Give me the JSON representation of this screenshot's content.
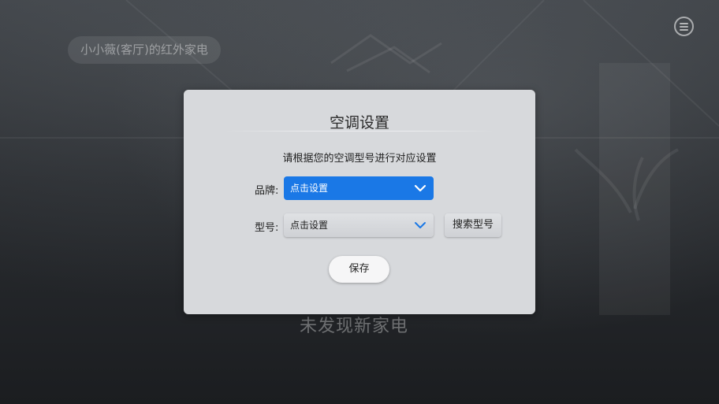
{
  "room": {
    "title": "小小薇(客厅)的红外家电"
  },
  "header": {
    "menu_icon": "menu-icon"
  },
  "main": {
    "empty_message": "未发现新家电"
  },
  "dialog": {
    "title": "空调设置",
    "subtitle": "请根据您的空调型号进行对应设置",
    "brand": {
      "label": "品牌:",
      "value": "点击设置",
      "chevron_icon": "chevron-down-icon"
    },
    "model": {
      "label": "型号:",
      "value": "点击设置",
      "chevron_icon": "chevron-down-icon"
    },
    "search_button": "搜索型号",
    "save_button": "保存"
  },
  "colors": {
    "accent": "#1a78e6",
    "dialog_bg": "#d7d9dc",
    "background": "#23262b"
  }
}
